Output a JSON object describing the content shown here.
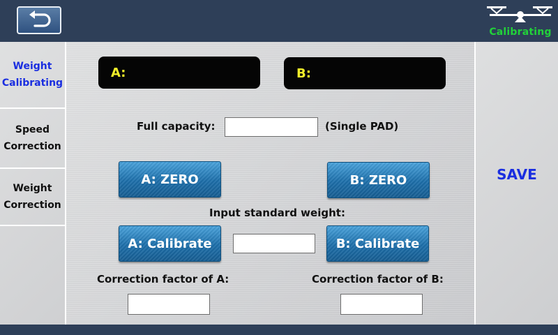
{
  "header": {
    "logo_text": "Calibrating",
    "logo_color": "#22d13a"
  },
  "sidebar": {
    "items": [
      {
        "label_1": "Weight",
        "label_2": "Calibrating",
        "active": true
      },
      {
        "label_1": "Speed",
        "label_2": "Correction",
        "active": false
      },
      {
        "label_1": "Weight",
        "label_2": "Correction",
        "active": false
      }
    ]
  },
  "displays": {
    "a_label": "A:",
    "b_label": "B:",
    "a_value": "",
    "b_value": ""
  },
  "capacity": {
    "label": "Full capacity:",
    "value": "",
    "suffix": "(Single PAD)"
  },
  "zero": {
    "a_label": "A:  ZERO",
    "b_label": "B:  ZERO"
  },
  "standard_weight": {
    "label": "Input standard weight:",
    "value": ""
  },
  "calibrate": {
    "a_label": "A:  Calibrate",
    "b_label": "B:  Calibrate"
  },
  "correction": {
    "a_label": "Correction factor of A:",
    "b_label": "Correction factor of B:",
    "a_value": "",
    "b_value": ""
  },
  "right_panel": {
    "save_label": "SAVE"
  },
  "colors": {
    "header_bg": "#2e3f58",
    "accent_blue": "#1a2ee0",
    "display_text": "#f2ef2a",
    "button_blue": "#1d6faa"
  }
}
